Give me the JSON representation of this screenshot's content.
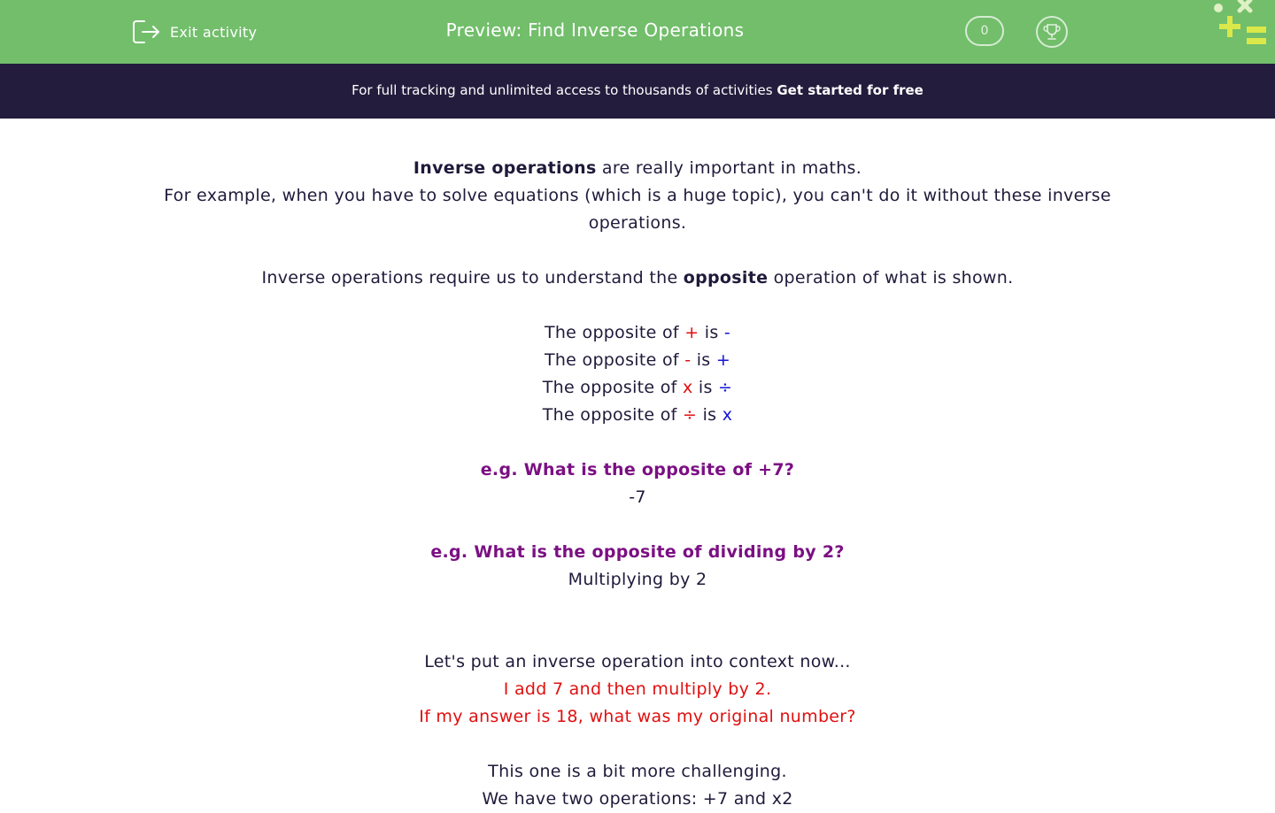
{
  "header": {
    "exit_label": "Exit activity",
    "title": "Preview: Find Inverse Operations",
    "score": "0",
    "bg_color": "#72be6b"
  },
  "banner": {
    "text": "For full tracking and unlimited access to thousands of activities ",
    "link": "Get started for free",
    "bg_color": "#241c3d"
  },
  "content": {
    "intro_bold": "Inverse operations",
    "intro_rest": " are really important in maths.",
    "intro_line2": "For example, when you have to solve equations (which is a huge topic), you can't do it without these inverse operations.",
    "opposite_pre": "Inverse operations require us to understand the ",
    "opposite_bold": "opposite",
    "opposite_post": " operation of what is shown.",
    "rows": [
      {
        "prefix": "The opposite of ",
        "op": "+",
        "mid": " is ",
        "inverse": "-"
      },
      {
        "prefix": "The opposite of ",
        "op": "-",
        "mid": " is ",
        "inverse": "+"
      },
      {
        "prefix": "The opposite of ",
        "op": "x",
        "mid": " is ",
        "inverse": "÷"
      },
      {
        "prefix": "The opposite of ",
        "op": "÷",
        "mid": " is ",
        "inverse": "x"
      }
    ],
    "example1_q": "e.g. What is the opposite of +7?",
    "example1_a": "-7",
    "example2_q": "e.g. What is the opposite of dividing by 2?",
    "example2_a": "Multiplying by 2",
    "context_intro": "Let's put an inverse operation into context now...",
    "context_line1": "I add 7 and then multiply by 2.",
    "context_line2": "If my answer is 18, what was my original number?",
    "challenge": "This one is a bit more challenging.",
    "challenge_cut": "We have two operations: +7 and x2"
  },
  "colors": {
    "red": "#e01010",
    "blue": "#1414d8",
    "purple": "#7b0f83"
  }
}
